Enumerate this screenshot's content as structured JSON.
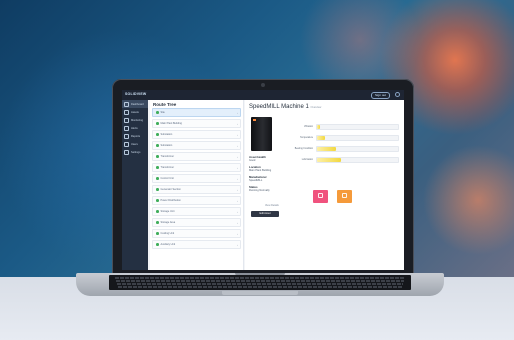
{
  "app": {
    "brand": "SOLIDVIEW",
    "logout_label": "Sign out"
  },
  "sidebar": {
    "items": [
      {
        "label": "Dashboard",
        "icon": "home-icon",
        "active": true
      },
      {
        "label": "Assets",
        "icon": "wrench-icon"
      },
      {
        "label": "Monitoring",
        "icon": "monitor-icon"
      },
      {
        "label": "Alerts",
        "icon": "bell-icon"
      },
      {
        "label": "Reports",
        "icon": "document-icon"
      },
      {
        "label": "Users",
        "icon": "users-icon"
      },
      {
        "label": "Settings",
        "icon": "gear-icon"
      }
    ]
  },
  "tree": {
    "title": "Route Tree",
    "rows": [
      {
        "label": "Site",
        "selected": true
      },
      {
        "label": "Main Plant Building"
      },
      {
        "label": "Substation"
      },
      {
        "label": "Substation"
      },
      {
        "label": "Transformer"
      },
      {
        "label": "Transformer"
      },
      {
        "label": "Control Unit"
      },
      {
        "label": "Generator Section"
      },
      {
        "label": "Power Distribution"
      },
      {
        "label": "Storage Unit"
      },
      {
        "label": "Storage Area"
      },
      {
        "label": "Cooling Unit"
      },
      {
        "label": "Auxiliary Unit"
      }
    ]
  },
  "detail": {
    "title": "SpeedMILL Machine 1",
    "subtitle": "Overview",
    "bars": [
      {
        "label": "Vibration",
        "value": 0.04
      },
      {
        "label": "Temperature",
        "value": 0.1
      },
      {
        "label": "Bearing Condition",
        "value": 0.24
      },
      {
        "label": "Lubrication",
        "value": 0.3
      }
    ],
    "stats": [
      {
        "label": "Asset Health",
        "value": "Good"
      },
      {
        "label": "Location",
        "value": "Main Plant Building"
      },
      {
        "label": "Manufacturer",
        "value": "SpeedMILL"
      },
      {
        "label": "Status",
        "value": "Running Normally"
      }
    ],
    "link_label": "View Details",
    "action_label": "Edit Asset"
  },
  "colors": {
    "alert_tile": "#f0527e",
    "warning_tile": "#f59a3a",
    "accent": "#f2d840",
    "nav_bg": "#243042"
  }
}
